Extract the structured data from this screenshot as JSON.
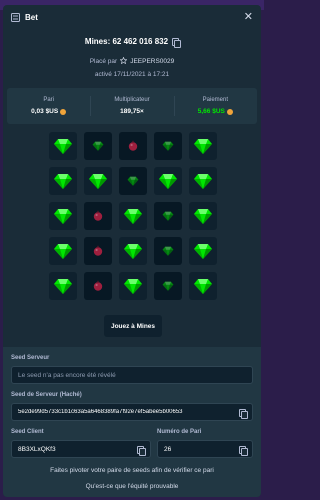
{
  "header": {
    "title": "Bet",
    "close_icon": "close-icon"
  },
  "bet": {
    "mines_title": "Mines: 62 462 016 832",
    "placed_by_prefix": "Placé par",
    "username": "JEEPERS0029",
    "date": "activé 17/11/2021 à 17:21"
  },
  "stats": {
    "bet_label": "Pari",
    "bet_value": "0,03 $US",
    "multiplier_label": "Multiplicateur",
    "multiplier_value": "189,75×",
    "payout_label": "Paiement",
    "payout_value": "5,66 $US"
  },
  "board": {
    "tiles": [
      "gem",
      "gem-dim",
      "mine-dim",
      "gem-dim",
      "gem",
      "gem",
      "gem",
      "gem-dim",
      "gem",
      "gem",
      "gem",
      "mine-dim",
      "gem",
      "gem-dim",
      "gem",
      "gem",
      "mine-dim",
      "gem",
      "gem-dim",
      "gem",
      "gem",
      "mine-dim",
      "gem",
      "gem-dim",
      "gem"
    ]
  },
  "play_button": "Jouez à Mines",
  "seeds": {
    "server_seed_label": "Seed Serveur",
    "server_seed_placeholder": "Le seed n'a pas encore été révélé",
    "hashed_label": "Seed de Serveur (Haché)",
    "hashed_value": "5e2de99d5733c1b1c63a5a6468389fa7f92e7ef5abee5b00653",
    "client_label": "Seed Client",
    "client_value": "8B3XLxQKf3",
    "nonce_label": "Numéro de Pari",
    "nonce_value": "26",
    "rotate_text": "Faites pivoter votre paire de seeds afin de vérifier ce pari",
    "fairness_link": "Qu'est-ce que l'équité prouvable"
  },
  "colors": {
    "gem": "#00e701",
    "mine": "#e0234a",
    "payout": "#00e701"
  }
}
